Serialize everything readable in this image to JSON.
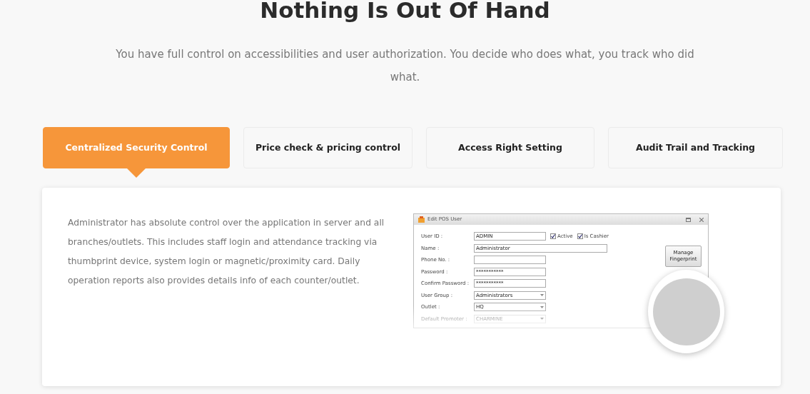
{
  "heading": "Nothing Is Out Of Hand",
  "intro": "You have full control on accessibilities and user authorization. You decide who does what, you track who did what.",
  "tabs": [
    {
      "label": "Centralized Security Control",
      "selected": true
    },
    {
      "label": "Price check & pricing control",
      "selected": false
    },
    {
      "label": "Access Right Setting",
      "selected": false
    },
    {
      "label": "Audit Trail and Tracking",
      "selected": false
    }
  ],
  "panel": {
    "text": "Administrator has absolute control over the application in server and all branches/outlets. This includes staff login and attendance tracking via thumbprint device, system login or magnetic/proximity card. Daily operation reports also provides details info of each counter/outlet.",
    "pos_window": {
      "title": "Edit POS User",
      "fields": [
        {
          "label": "User ID :",
          "value": "ADMIN",
          "kind": "text",
          "wide": false,
          "disabled": false
        },
        {
          "label": "Name :",
          "value": "Administrator",
          "kind": "text",
          "wide": true,
          "disabled": false
        },
        {
          "label": "Phone No. :",
          "kind": "text",
          "wide": false,
          "disabled": false
        },
        {
          "label": "Password :",
          "value": "***********",
          "kind": "text",
          "wide": false,
          "disabled": false
        },
        {
          "label": "Confirm Password :",
          "value": "***********",
          "kind": "text",
          "wide": false,
          "disabled": false
        },
        {
          "label": "User Group :",
          "value": "Administrators",
          "kind": "select",
          "wide": false,
          "disabled": false
        },
        {
          "label": "Outlet :",
          "value": "HQ",
          "kind": "select",
          "wide": false,
          "disabled": false
        },
        {
          "label": "Default Promoter :",
          "value": "CHARMINE",
          "kind": "select",
          "wide": false,
          "disabled": true
        }
      ],
      "checkboxes": [
        {
          "label": "Active",
          "checked": true
        },
        {
          "label": "Is Cashier",
          "checked": true
        }
      ],
      "button": "Manage Fingerprint"
    }
  }
}
